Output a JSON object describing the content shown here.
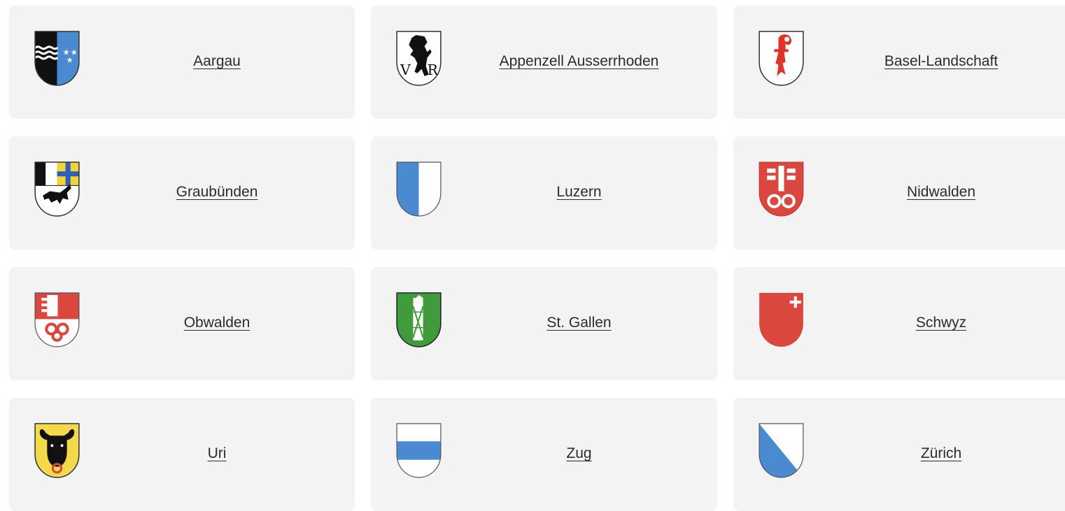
{
  "cantons": [
    {
      "name": "Aargau",
      "crest": "aargau-crest-icon"
    },
    {
      "name": "Appenzell Ausserrhoden",
      "crest": "appenzell-ausserrhoden-crest-icon"
    },
    {
      "name": "Basel-Landschaft",
      "crest": "basel-landschaft-crest-icon"
    },
    {
      "name": "Graubünden",
      "crest": "graubuenden-crest-icon"
    },
    {
      "name": "Luzern",
      "crest": "luzern-crest-icon"
    },
    {
      "name": "Nidwalden",
      "crest": "nidwalden-crest-icon"
    },
    {
      "name": "Obwalden",
      "crest": "obwalden-crest-icon"
    },
    {
      "name": "St. Gallen",
      "crest": "st-gallen-crest-icon"
    },
    {
      "name": "Schwyz",
      "crest": "schwyz-crest-icon"
    },
    {
      "name": "Uri",
      "crest": "uri-crest-icon"
    },
    {
      "name": "Zug",
      "crest": "zug-crest-icon"
    },
    {
      "name": "Zürich",
      "crest": "zuerich-crest-icon"
    }
  ],
  "colors": {
    "card_background": "#f3f3f3",
    "link_text": "#2b2b2b",
    "swiss_blue": "#4a8ad0",
    "swiss_red": "#d9473f",
    "swiss_green": "#3f9b3b",
    "uri_yellow": "#f4d94a"
  }
}
